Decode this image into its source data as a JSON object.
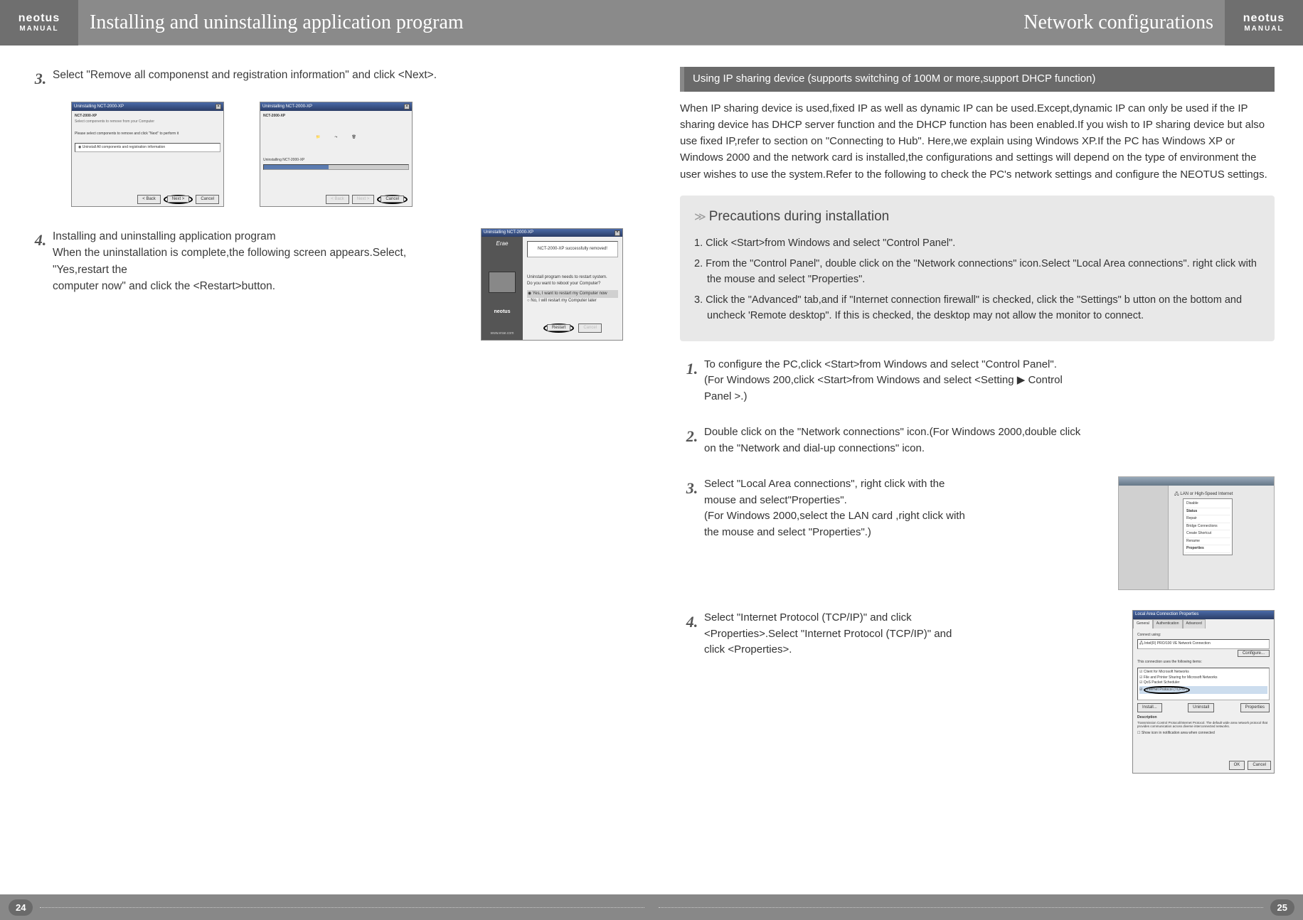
{
  "brand": {
    "name": "neotus",
    "sub": "MANUAL"
  },
  "left": {
    "header": "Installing and uninstalling application program",
    "step3_num": "3.",
    "step3_text": "Select \"Remove all componenst and registration information\" and click <Next>.",
    "win_title": "Uninstalling NCT-2000-XP",
    "win_head": "NCT-2000-XP",
    "win_sub": "Select components to remove from your Computer",
    "win_prompt": "Please select components to remove and click \"Next\" to perform it",
    "win_option": "Uninstall All components and registration information",
    "btn_back": "< Back",
    "btn_next": "Next >",
    "btn_cancel": "Cancel",
    "win2_progress": "Uninstalling NCT-2000-XP",
    "step4_num": "4.",
    "step4_text": "Installing and uninstalling application program\nWhen the uninstallation is complete,the following screen appears.Select, \"Yes,restart the\ncomputer now\" and click the <Restart>button.",
    "restart_brand": "Erae",
    "restart_sub": "neotus",
    "restart_url": "www.erae.com",
    "restart_msg1": "NCT-2000-XP successfully removed!",
    "restart_msg2": "Uninstall program needs to restart system.\nDo you want to reboot your Computer?",
    "restart_opt1": "Yes, I want to restart my Computer now",
    "restart_opt2": "No, I will restart my Computer later",
    "btn_restart": "Restart",
    "page_num": "24"
  },
  "right": {
    "header": "Network configurations",
    "subhead": "Using IP sharing device (supports switching of 100M or more,support DHCP function)",
    "intro": "When IP sharing device is used,fixed IP as well as dynamic IP can be used.Except,dynamic IP can only be used if the IP sharing device has DHCP server function and the DHCP function has been enabled.If you wish to IP sharing device but also use fixed IP,refer to section on \"Connecting to Hub\". Here,we explain using Windows XP.If the PC has Windows XP or Windows 2000 and the network card is installed,the configurations and settings will depend on the type of environment the user wishes to use the system.Refer to the following to check the PC's network settings and configure the NEOTUS settings.",
    "prec_title": "Precautions during installation",
    "prec1": "1. Click <Start>from Windows and select \"Control Panel\".",
    "prec2": "2. From the \"Control Panel\", double click on the \"Network connections\" icon.Select \"Local Area connections\". right click with the mouse and select \"Properties\".",
    "prec3": "3. Click the \"Advanced\" tab,and if \"Internet connection firewall\" is checked, click the \"Settings\" b utton on the bottom and uncheck 'Remote desktop\". If this is checked, the desktop may not allow the monitor to connect.",
    "s1_num": "1.",
    "s1_text": "To configure the PC,click <Start>from Windows and select \"Control Panel\".\n(For Windows 200,click <Start>from Windows and select <Setting ▶ Control Panel >.)",
    "s2_num": "2.",
    "s2_text": "Double click on the \"Network connections\" icon.(For Windows 2000,double click on the \"Network and dial-up connections\" icon.",
    "s3_num": "3.",
    "s3_text": "Select \"Local Area connections\", right click with the mouse and select\"Properties\".\n(For Windows 2000,select the LAN card ,right click with the mouse and select \"Properties\".)",
    "s4_num": "4.",
    "s4_text": "Select \"Internet Protocol (TCP/IP)\" and click <Properties>.Select \"Internet Protocol (TCP/IP)\" and click <Properties>.",
    "ctx_items": [
      "Disable",
      "Status",
      "Repair",
      "",
      "Bridge Connections",
      "Create Shortcut",
      "",
      "Rename",
      "",
      "Properties"
    ],
    "prop_title": "Local Area Connection Properties",
    "prop_tabs": [
      "General",
      "Authentication",
      "Advanced"
    ],
    "prop_connect": "Connect using:",
    "prop_adapter": "Intel(R) PRO/100 VE Network Connection",
    "prop_config": "Configure...",
    "prop_uses": "This connection uses the following items:",
    "prop_items": [
      "Client for Microsoft Networks",
      "File and Printer Sharing for Microsoft Networks",
      "QoS Packet Scheduler",
      "Internet Protocol (TCP/IP)"
    ],
    "prop_install": "Install...",
    "prop_uninstall": "Uninstall",
    "prop_props": "Properties",
    "prop_desc_h": "Description",
    "prop_desc": "Transmission Control Protocol/Internet Protocol. The default wide area network protocol that provides communication across diverse interconnected networks.",
    "prop_notify": "Show icon in notification area when connected",
    "btn_ok": "OK",
    "btn_cancel": "Cancel",
    "page_num": "25"
  }
}
